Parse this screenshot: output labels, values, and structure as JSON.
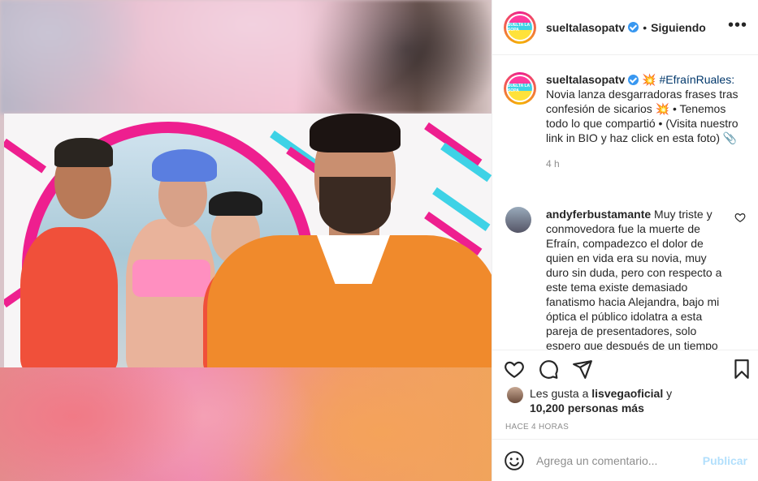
{
  "post": {
    "username": "sueltalasopatv",
    "dot": "•",
    "follow_status": "Siguiendo",
    "more": "•••",
    "avatar_text": "SUELTA LA SOPA",
    "caption": {
      "username": "sueltalasopatv",
      "hashtag": "#EfraínRuales:",
      "text_1": " Novia lanza desgarradoras frases tras confesión de sicarios ",
      "text_2": " • Tenemos todo lo que compartió • (Visita nuestro link in BIO y haz click en esta foto) ",
      "time": "4 h",
      "emoji_1": "💥",
      "emoji_2": "💥",
      "emoji_3": "📎"
    },
    "comment": {
      "username": "andyferbustamante",
      "text": " Muy triste y conmovedora fue la muerte de Efraín, compadezco el dolor de quien en vida era su novia, muy duro sin duda, pero con respecto a este tema existe demasiado fanatismo hacia Alejandra, bajo mi óptica el público idolatra a esta pareja de presentadores, solo espero que después de un tiempo"
    },
    "likes": {
      "prefix": "Les gusta a ",
      "user": "lisvegaoficial",
      "mid": " y",
      "count": "10,200 personas más"
    },
    "time_ago": "HACE 4 HORAS",
    "add_comment": {
      "placeholder": "Agrega un comentario...",
      "publish": "Publicar"
    }
  },
  "colors": {
    "accent_pink": "#ee1f8f",
    "verified_blue": "#3897f0",
    "publish_disabled": "#b2dffc",
    "hashtag": "#00376b"
  },
  "icons": [
    "heart-icon",
    "comment-icon",
    "share-icon",
    "bookmark-icon",
    "emoji-icon",
    "verified-badge-icon",
    "more-options-icon"
  ]
}
